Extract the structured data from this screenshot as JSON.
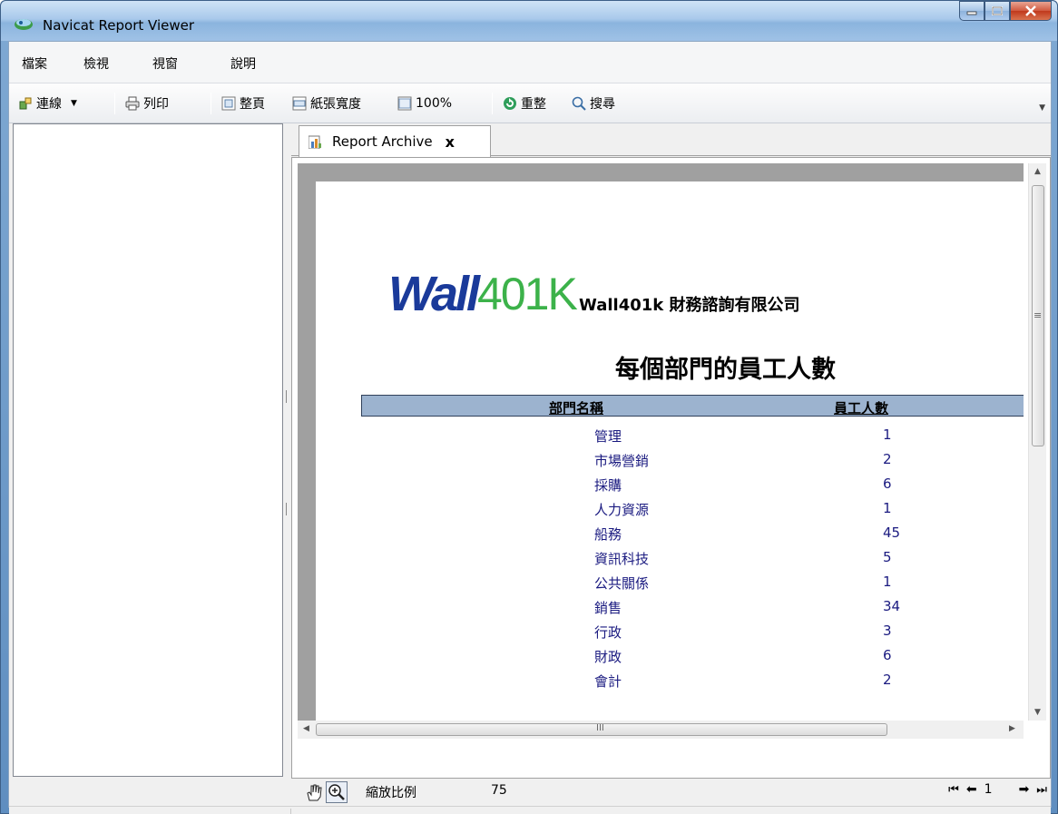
{
  "window": {
    "title": "Navicat Report Viewer",
    "icon": "navicat-icon"
  },
  "menu": [
    "檔案",
    "檢視",
    "視窗",
    "說明"
  ],
  "toolbar": {
    "connect": "連線",
    "print": "列印",
    "whole_page": "整頁",
    "page_width": "紙張寬度",
    "zoom100": "100%",
    "refresh": "重整",
    "search": "搜尋"
  },
  "tab": {
    "label": "Report Archive",
    "close": "x"
  },
  "report": {
    "company": "Wall401k 財務諮詢有限公司",
    "logo_left": "Wall",
    "logo_right": "401K",
    "title": "每個部門的員工人數",
    "header_name": "部門名稱",
    "header_count": "員工人數",
    "rows": [
      {
        "name": "管理",
        "count": "1"
      },
      {
        "name": "市場營銷",
        "count": "2"
      },
      {
        "name": "採購",
        "count": "6"
      },
      {
        "name": "人力資源",
        "count": "1"
      },
      {
        "name": "船務",
        "count": "45"
      },
      {
        "name": "資訊科技",
        "count": "5"
      },
      {
        "name": "公共關係",
        "count": "1"
      },
      {
        "name": "銷售",
        "count": "34"
      },
      {
        "name": "行政",
        "count": "3"
      },
      {
        "name": "財政",
        "count": "6"
      },
      {
        "name": "會計",
        "count": "2"
      }
    ]
  },
  "zoom": {
    "label": "縮放比例",
    "value": "75"
  },
  "pager": {
    "current": "1"
  },
  "scroll": {
    "h_scroll_label": "III",
    "v_scroll_label": "≡"
  }
}
